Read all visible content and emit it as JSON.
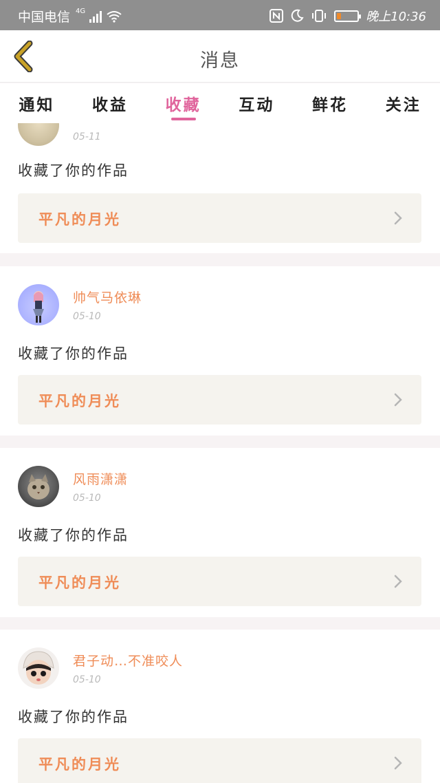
{
  "status_bar": {
    "carrier": "中国电信",
    "network": "4G",
    "time": "晚上10:36",
    "battery_level": 0.2,
    "colors": {
      "background": "#8f8f8f",
      "battery": "#f08a2a"
    },
    "icons": [
      "signal-icon",
      "wifi-icon",
      "nfc-icon",
      "moon-icon",
      "vibrate-icon",
      "battery-icon"
    ]
  },
  "header": {
    "title": "消息",
    "back_icon": "chevron-left-icon",
    "back_color": "#c9a227"
  },
  "tabs": [
    {
      "label": "通知",
      "active": false
    },
    {
      "label": "收益",
      "active": false
    },
    {
      "label": "收藏",
      "active": true
    },
    {
      "label": "互动",
      "active": false
    },
    {
      "label": "鲜花",
      "active": false
    },
    {
      "label": "关注",
      "active": false
    }
  ],
  "accent_color": "#e0649c",
  "username_color": "#ef8c57",
  "messages": [
    {
      "username": "",
      "date": "05-11",
      "action": "收藏了你的作品",
      "work_title": "平凡的月光"
    },
    {
      "username": "帅气马依琳",
      "date": "05-10",
      "action": "收藏了你的作品",
      "work_title": "平凡的月光"
    },
    {
      "username": "风雨潇潇",
      "date": "05-10",
      "action": "收藏了你的作品",
      "work_title": "平凡的月光"
    },
    {
      "username": "君子动…不准咬人",
      "date": "05-10",
      "action": "收藏了你的作品",
      "work_title": "平凡的月光"
    }
  ]
}
